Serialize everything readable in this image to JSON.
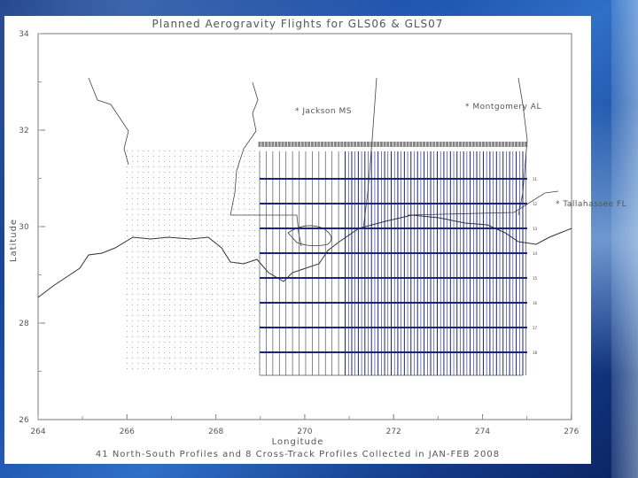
{
  "map": {
    "title": "Planned Aerogravity Flights for GLS06 & GLS07",
    "xlabel": "Longitude",
    "ylabel": "Latitude",
    "caption": "41 North-South Profiles and 8 Cross-Track Profiles Collected in JAN-FEB 2008",
    "x_ticks": [
      "264",
      "266",
      "268",
      "270",
      "272",
      "274",
      "276"
    ],
    "y_ticks": [
      "34",
      "32",
      "30",
      "28",
      "26"
    ],
    "cities": [
      {
        "name": "Jackson MS"
      },
      {
        "name": "Montgomery AL"
      },
      {
        "name": "Tallahassee FL"
      }
    ],
    "cross_track_labels": [
      "11",
      "12",
      "13",
      "14",
      "15",
      "16",
      "17",
      "18"
    ],
    "colors": {
      "background": "#ffffff",
      "flight_lines": "#1a237e",
      "coast": "#333333",
      "grid_dots": "#888888",
      "slide_frame": "#1b4fa8"
    }
  }
}
